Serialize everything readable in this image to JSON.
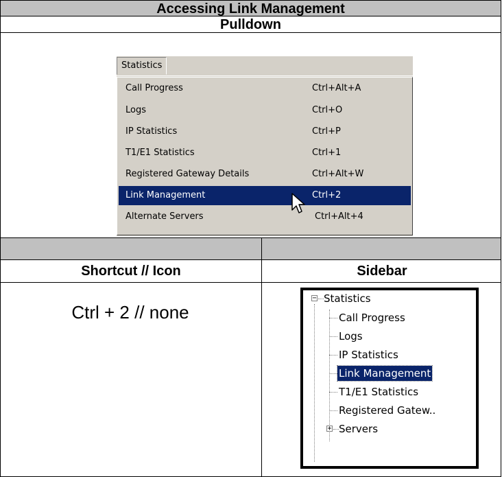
{
  "header": {
    "title": "Accessing Link Management",
    "subtitle": "Pulldown"
  },
  "pulldown": {
    "menu_title": "Statistics",
    "items": [
      {
        "label": "Call Progress",
        "shortcut": "Ctrl+Alt+A",
        "selected": false
      },
      {
        "label": "Logs",
        "shortcut": "Ctrl+O",
        "selected": false
      },
      {
        "label": "IP Statistics",
        "shortcut": "Ctrl+P",
        "selected": false
      },
      {
        "label": "T1/E1 Statistics",
        "shortcut": "Ctrl+1",
        "selected": false
      },
      {
        "label": "Registered Gateway Details",
        "shortcut": "Ctrl+Alt+W",
        "selected": false
      },
      {
        "label": "Link Management",
        "shortcut": "Ctrl+2",
        "selected": true
      },
      {
        "label": "Alternate Servers",
        "shortcut": "Ctrl+Alt+4",
        "selected": false
      }
    ],
    "colors": {
      "menu_bg": "#d4d0c8",
      "selection_bg": "#0a246a",
      "selection_fg": "#ffffff"
    }
  },
  "columns": {
    "shortcut_header": "Shortcut // Icon",
    "sidebar_header": "Sidebar"
  },
  "shortcut_value": "Ctrl + 2 // none",
  "sidebar": {
    "root": "Statistics",
    "root_expander": "−",
    "children": [
      {
        "label": "Call Progress",
        "selected": false
      },
      {
        "label": "Logs",
        "selected": false
      },
      {
        "label": "IP Statistics",
        "selected": false
      },
      {
        "label": "Link Management",
        "selected": true
      },
      {
        "label": "T1/E1 Statistics",
        "selected": false
      },
      {
        "label": "Registered Gatew..",
        "selected": false
      }
    ],
    "next_root": "Servers",
    "next_root_expander": "+"
  },
  "icons": {
    "cursor": "mouse-pointer-icon",
    "collapse": "minus-box-icon",
    "expand": "plus-box-icon"
  }
}
